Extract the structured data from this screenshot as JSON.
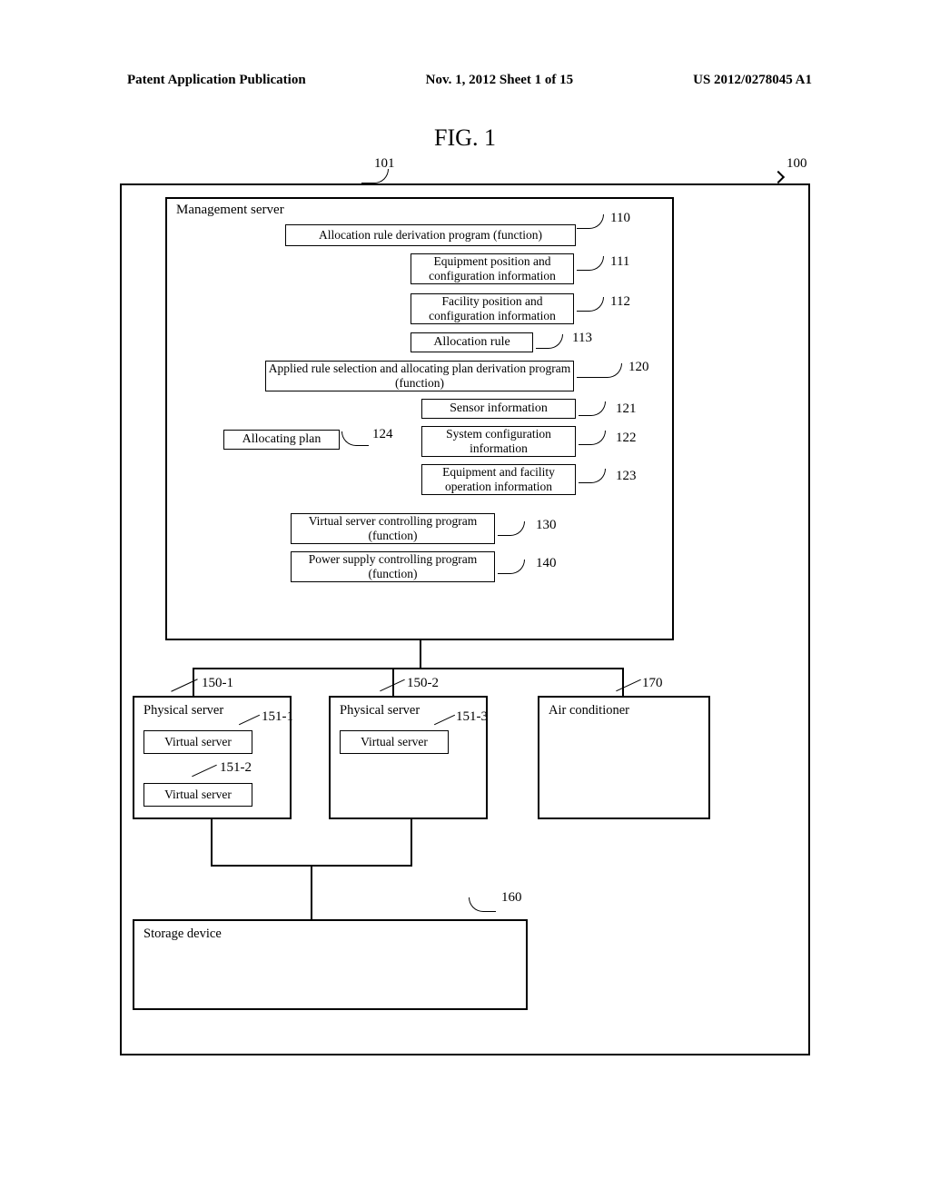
{
  "header": {
    "left": "Patent Application Publication",
    "center": "Nov. 1, 2012  Sheet 1 of 15",
    "right": "US 2012/0278045 A1"
  },
  "figure_title": "FIG. 1",
  "labels": {
    "l100": "100",
    "l101": "101",
    "l110": "110",
    "l111": "111",
    "l112": "112",
    "l113": "113",
    "l120": "120",
    "l121": "121",
    "l122": "122",
    "l123": "123",
    "l124": "124",
    "l130": "130",
    "l140": "140",
    "l150_1": "150-1",
    "l150_2": "150-2",
    "l151_1": "151-1",
    "l151_2": "151-2",
    "l151_3": "151-3",
    "l160": "160",
    "l170": "170"
  },
  "boxes": {
    "mgmt_server": "Management server",
    "b110": "Allocation rule derivation program (function)",
    "b111": "Equipment position and configuration information",
    "b112": "Facility position and configuration information",
    "b113": "Allocation rule",
    "b120": "Applied rule selection and allocating plan derivation program (function)",
    "b121": "Sensor information",
    "b122": "System configuration information",
    "b123": "Equipment and facility operation information",
    "b124": "Allocating plan",
    "b130": "Virtual server controlling program (function)",
    "b140": "Power supply controlling program (function)",
    "physical_server": "Physical server",
    "virtual_server": "Virtual server",
    "air_conditioner": "Air conditioner",
    "storage_device": "Storage device"
  }
}
